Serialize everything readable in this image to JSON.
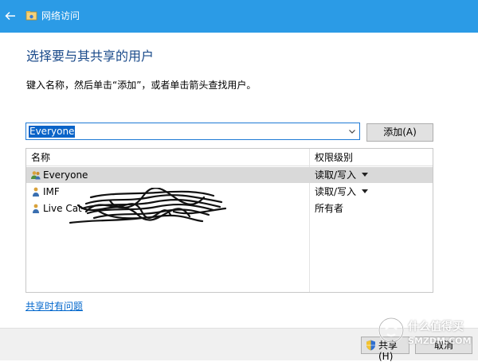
{
  "window": {
    "title": "网络访问",
    "back_icon": "back-arrow-icon",
    "app_icon": "network-folder-icon",
    "titlebar_color": "#2b9be6"
  },
  "main": {
    "heading": "选择要与其共享的用户",
    "instruction": "键入名称，然后单击“添加”，或者单击箭头查找用户。",
    "combo_value": "Everyone",
    "add_label": "添加(A)"
  },
  "list": {
    "columns": [
      "名称",
      "权限级别"
    ],
    "rows": [
      {
        "name": "Everyone",
        "permission": "读取/写入",
        "icon": "group-users-icon",
        "selected": true
      },
      {
        "name": "IMF",
        "permission": "读取/写入",
        "icon": "user-icon",
        "selected": false
      },
      {
        "name": "Live Cat",
        "permission": "所有者",
        "icon": "user-icon",
        "selected": false
      }
    ]
  },
  "footer": {
    "help_link": "共享时有问题",
    "share_label": "共享(H)",
    "cancel_label": "取消"
  },
  "watermark": {
    "text": "什么值得买",
    "url": "SMZDM.COM"
  }
}
